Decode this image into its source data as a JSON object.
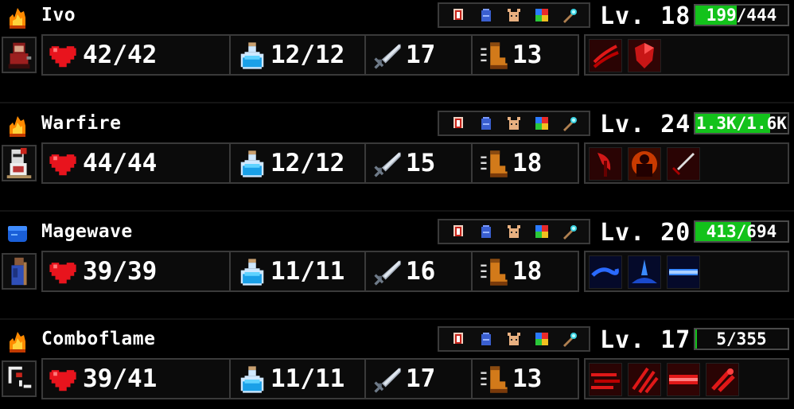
{
  "colors": {
    "xp_fill": "#13c21b",
    "border": "#3a3a3a",
    "panel": "#0b0b0b"
  },
  "menu_icons": [
    "armor-icon",
    "bag-icon",
    "pet-icon",
    "grid-icon",
    "staff-icon"
  ],
  "characters": [
    {
      "name": "Ivo",
      "element_icon": "fire-icon",
      "portrait": "rogue-portrait",
      "level": "Lv. 18",
      "xp_text": "199/444",
      "xp_progress": 0.45,
      "hp": "42/42",
      "mana": "12/12",
      "attack": "17",
      "speed": "13",
      "skills": [
        "claw-slash-skill",
        "red-shield-skill"
      ]
    },
    {
      "name": "Warfire",
      "element_icon": "fire-icon",
      "portrait": "knight-portrait",
      "level": "Lv. 24",
      "xp_text": "1.3K/1.6K",
      "xp_progress": 0.81,
      "hp": "44/44",
      "mana": "12/12",
      "attack": "15",
      "speed": "18",
      "skills": [
        "axe-skill",
        "rage-skill",
        "sword-skill"
      ]
    },
    {
      "name": "Magewave",
      "element_icon": "water-icon",
      "portrait": "mage-portrait",
      "level": "Lv. 20",
      "xp_text": "413/694",
      "xp_progress": 0.6,
      "hp": "39/39",
      "mana": "11/11",
      "attack": "16",
      "speed": "18",
      "skills": [
        "water-bolt-skill",
        "water-splash-skill",
        "water-beam-skill"
      ]
    },
    {
      "name": "Comboflame",
      "element_icon": "fire-icon",
      "portrait": "monk-portrait",
      "level": "Lv. 17",
      "xp_text": "5/355",
      "xp_progress": 0.014,
      "hp": "39/41",
      "mana": "11/11",
      "attack": "17",
      "speed": "13",
      "skills": [
        "fire-dash-skill",
        "fire-claw-skill",
        "fire-beam-skill",
        "fire-strike-skill"
      ]
    }
  ]
}
